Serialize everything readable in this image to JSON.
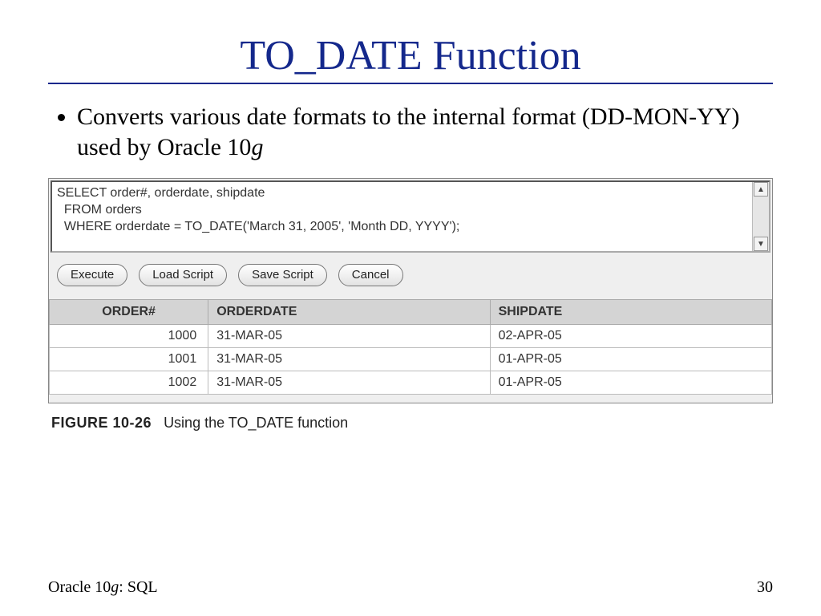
{
  "title": "TO_DATE Function",
  "bullet_prefix": "Converts various date formats to the internal format (DD-MON-YY) used by Oracle 10",
  "bullet_suffix_italic": "g",
  "sql": {
    "line1": "SELECT order#, orderdate, shipdate",
    "line2": "  FROM orders",
    "line3": "  WHERE orderdate = TO_DATE('March 31, 2005', 'Month DD, YYYY');"
  },
  "buttons": {
    "execute": "Execute",
    "load": "Load Script",
    "save": "Save Script",
    "cancel": "Cancel"
  },
  "table": {
    "headers": {
      "c1": "ORDER#",
      "c2": "ORDERDATE",
      "c3": "SHIPDATE"
    },
    "rows": [
      {
        "order": "1000",
        "orderdate": "31-MAR-05",
        "shipdate": "02-APR-05"
      },
      {
        "order": "1001",
        "orderdate": "31-MAR-05",
        "shipdate": "01-APR-05"
      },
      {
        "order": "1002",
        "orderdate": "31-MAR-05",
        "shipdate": "01-APR-05"
      }
    ]
  },
  "caption": {
    "label": "FIGURE 10-26",
    "text": "Using the TO_DATE function"
  },
  "footer": {
    "left_prefix": "Oracle 10",
    "left_italic": "g",
    "left_suffix": ": SQL",
    "page": "30"
  }
}
